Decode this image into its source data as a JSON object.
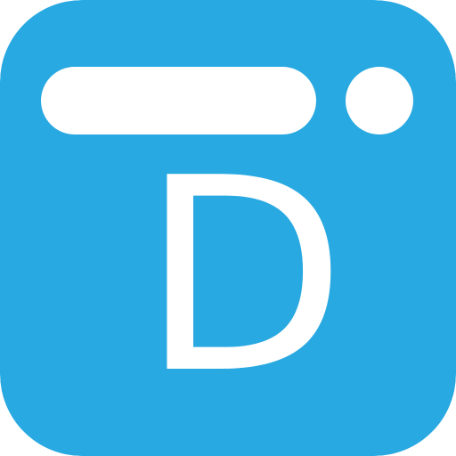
{
  "app_icon": {
    "letter": "D",
    "icon_name": "app-icon",
    "colors": {
      "background": "#29A9E1",
      "foreground": "#FFFFFF"
    }
  }
}
